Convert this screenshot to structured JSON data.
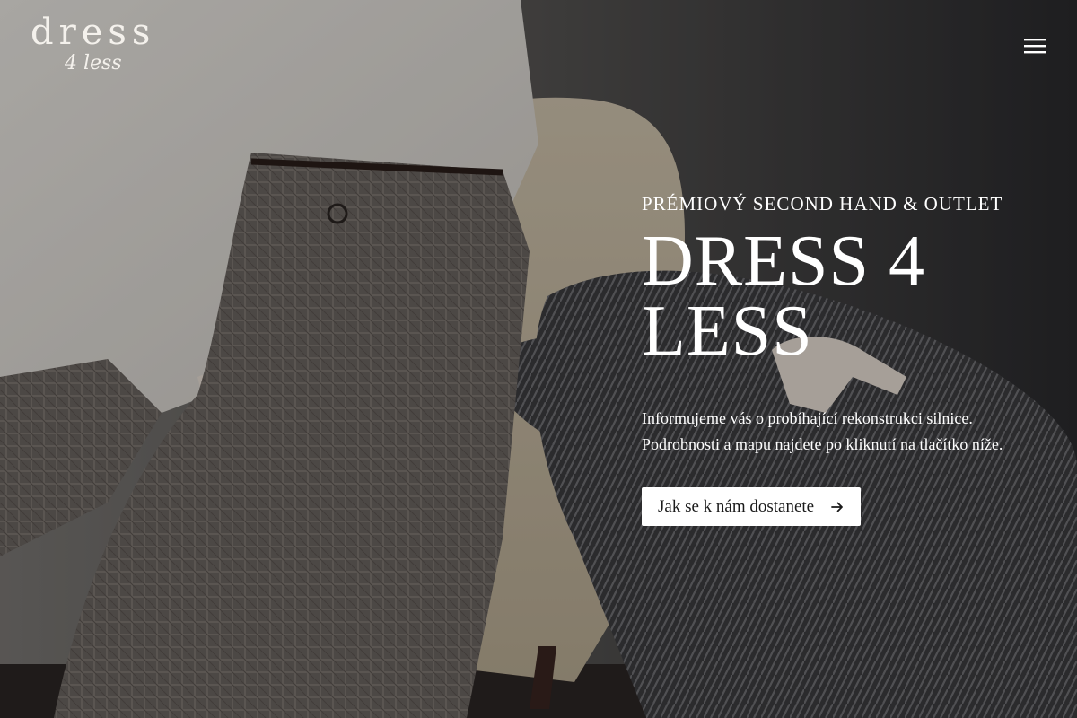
{
  "brand": {
    "logo_word": "dress",
    "logo_sub": "4 less"
  },
  "header": {
    "menu_icon": "hamburger-menu-icon"
  },
  "hero": {
    "eyebrow": "PRÉMIOVÝ SECOND HAND & OUTLET",
    "headline_line1": "DRESS 4",
    "headline_line2": "LESS",
    "intro": "Informujeme vás o probíhající rekonstrukci silnice. Podrobnosti a mapu najdete po kliknutí na tlačítko níže.",
    "cta_label": "Jak se k nám dostanete",
    "cta_icon": "arrow-right-icon"
  },
  "colors": {
    "text": "#ffffff",
    "button_bg": "#ffffff",
    "button_text": "#1a1a1a",
    "overlay": "rgba(0,0,0,0.28)"
  }
}
